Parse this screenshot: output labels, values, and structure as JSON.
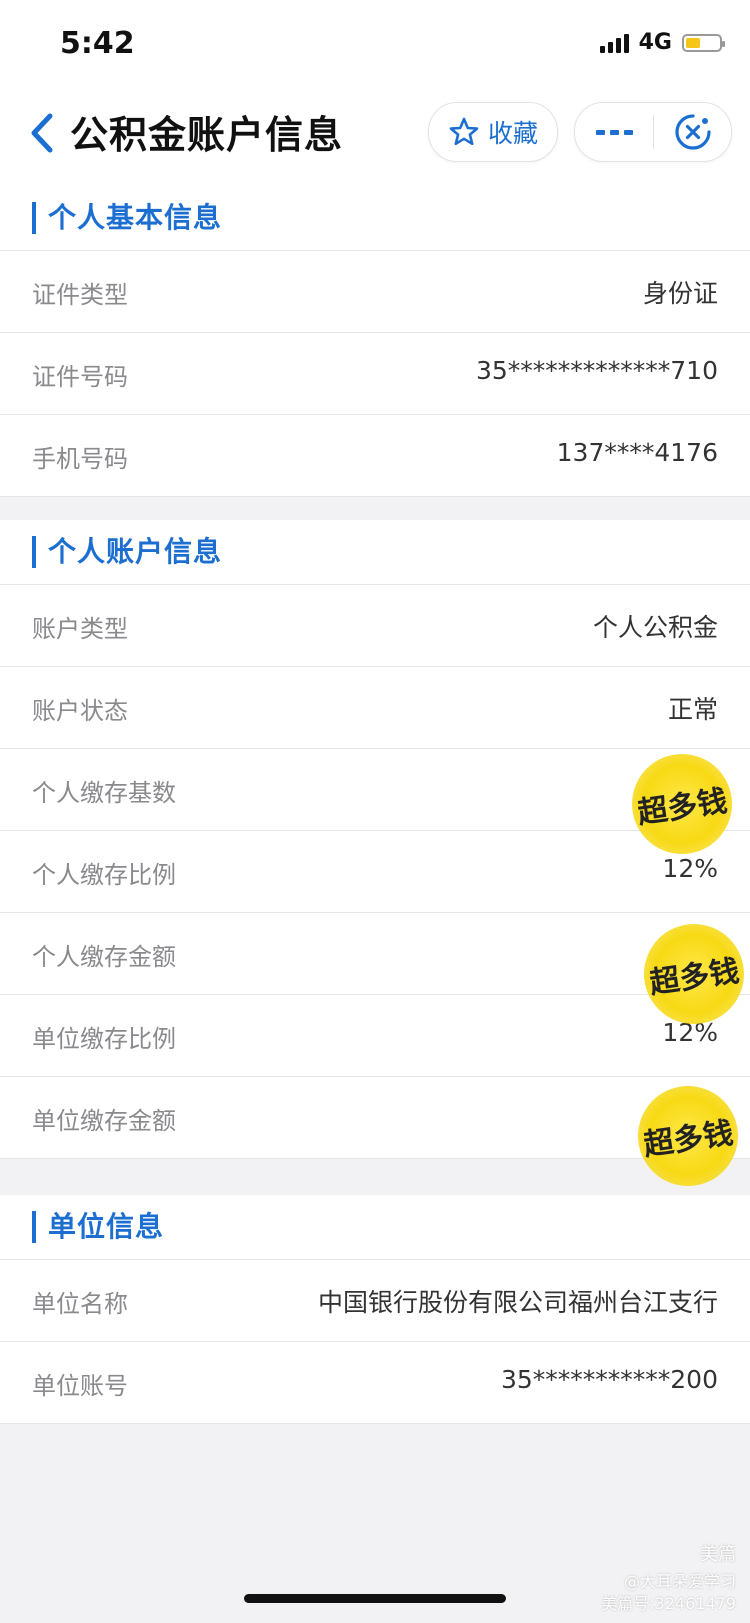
{
  "status_bar": {
    "time": "5:42",
    "network": "4G"
  },
  "nav": {
    "title": "公积金账户信息",
    "favorite_label": "收藏"
  },
  "sections": [
    {
      "title": "个人基本信息",
      "rows": [
        {
          "label": "证件类型",
          "value": "身份证"
        },
        {
          "label": "证件号码",
          "value": "35*************710"
        },
        {
          "label": "手机号码",
          "value": "137****4176"
        }
      ]
    },
    {
      "title": "个人账户信息",
      "rows": [
        {
          "label": "账户类型",
          "value": "个人公积金"
        },
        {
          "label": "账户状态",
          "value": "正常"
        },
        {
          "label": "个人缴存基数",
          "value": ""
        },
        {
          "label": "个人缴存比例",
          "value": "12%"
        },
        {
          "label": "个人缴存金额",
          "value": ""
        },
        {
          "label": "单位缴存比例",
          "value": "12%"
        },
        {
          "label": "单位缴存金额",
          "value": ""
        }
      ]
    },
    {
      "title": "单位信息",
      "rows": [
        {
          "label": "单位名称",
          "value": "中国银行股份有限公司福州台江支行"
        },
        {
          "label": "单位账号",
          "value": "35***********200"
        }
      ]
    }
  ],
  "stickers": {
    "text": "超多钱"
  },
  "watermark": {
    "brand": "美篇",
    "author": "@大耳朵爱学习",
    "id": "美篇号:32461479"
  },
  "colors": {
    "accent": "#1c6fd1",
    "battery": "#f5c518",
    "sticker": "#f7d914"
  },
  "icons": {
    "back": "chevron-left-icon",
    "favorite": "star-outline-icon",
    "more": "more-dots-icon",
    "close": "close-target-icon"
  }
}
